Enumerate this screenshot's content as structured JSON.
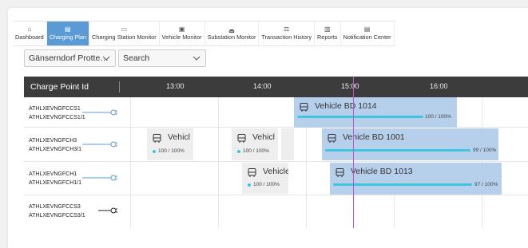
{
  "nav": {
    "items": [
      {
        "label": "Dashboard",
        "icon": "home-icon",
        "glyph": "⌂",
        "active": false
      },
      {
        "label": "Charging Plan",
        "icon": "calendar-icon",
        "glyph": "▤",
        "active": true
      },
      {
        "label": "Charging Station Monitor",
        "icon": "station-icon",
        "glyph": "▭",
        "active": false
      },
      {
        "label": "Vehicle Monitor",
        "icon": "bus-icon",
        "glyph": "▣",
        "active": false
      },
      {
        "label": "Substation Monitor",
        "icon": "substation-icon",
        "glyph": "◛",
        "active": false
      },
      {
        "label": "Transaction History",
        "icon": "history-icon",
        "glyph": "⚖",
        "active": false
      },
      {
        "label": "Reports",
        "icon": "reports-icon",
        "glyph": "▥",
        "active": false
      },
      {
        "label": "Notification Center",
        "icon": "notification-icon",
        "glyph": "▤",
        "active": false
      }
    ]
  },
  "filters": {
    "location": "Gänserndorf Protte…",
    "search": "Search"
  },
  "gantt": {
    "header": "Charge Point Id",
    "times": [
      "13:00",
      "14:00",
      "15:00",
      "16:00"
    ],
    "rows": [
      {
        "id1": "ATHLXEVNGFCCS1",
        "id2": "ATHLXEVNGFCCS1/1"
      },
      {
        "id1": "ATHLXEVNGFCH3",
        "id2": "ATHLXEVNGFCH3/1"
      },
      {
        "id1": "ATHLXEVNGFCH1",
        "id2": "ATHLXEVNGFCH1/1"
      },
      {
        "id1": "ATHLXEVNGFCCS3",
        "id2": "ATHLXEVNGFCCS3/1"
      }
    ],
    "sessions": {
      "s1": {
        "name": "Vehicle BD 1014",
        "progress": "100 / 100%"
      },
      "s2": {
        "name": "Vehicl",
        "progress": "100 / 100%"
      },
      "s3": {
        "name": "Vehicl",
        "progress": "100 / 100%"
      },
      "s4": {
        "name": "Vehicle BD 1001",
        "progress": "99 / 100%"
      },
      "s5": {
        "name": "Vehicle",
        "progress": "100 / 100%"
      },
      "s6": {
        "name": "Vehicle BD 1013",
        "progress": "97 / 100%"
      }
    }
  },
  "colors": {
    "accent": "#5b9bd5",
    "session": "#b6d0ec",
    "progress": "#3fc6df",
    "now_line": "#c34fc9"
  }
}
